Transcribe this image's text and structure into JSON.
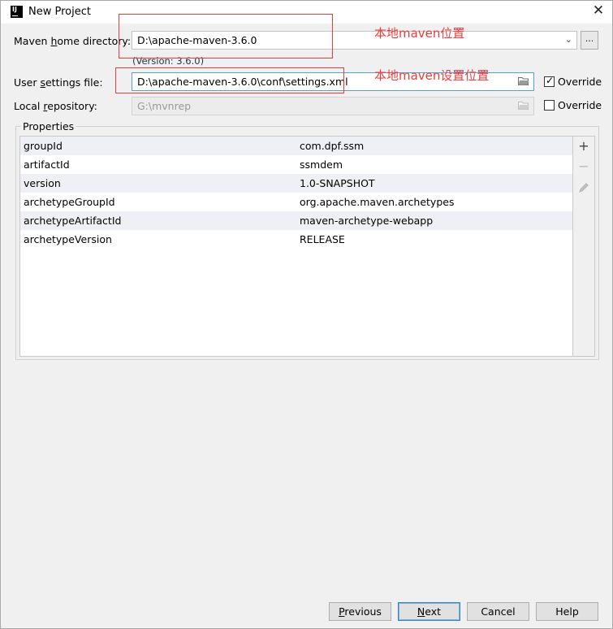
{
  "window": {
    "title": "New Project",
    "icon_text": "IJ"
  },
  "maven": {
    "home_label_pre": "Maven ",
    "home_label_u": "h",
    "home_label_post": "ome directory:",
    "home_value": "D:\\apache-maven-3.6.0",
    "version_text": "(Version: 3.6.0)",
    "settings_label_pre": "User ",
    "settings_label_u": "s",
    "settings_label_post": "ettings file:",
    "settings_value": "D:\\apache-maven-3.6.0\\conf\\settings.xml",
    "settings_override_checked": true,
    "override_label": "Override",
    "repo_label_pre": "Local ",
    "repo_label_u": "r",
    "repo_label_post": "epository:",
    "repo_value": "G:\\mvnrep",
    "repo_override_checked": false,
    "browse_label": "..."
  },
  "annotations": {
    "home_note": "本地maven位置",
    "settings_note": "本地maven设置位置",
    "color": "#e83c3c"
  },
  "properties": {
    "title": "Properties",
    "rows": [
      {
        "key": "groupId",
        "value": "com.dpf.ssm"
      },
      {
        "key": "artifactId",
        "value": "ssmdem"
      },
      {
        "key": "version",
        "value": "1.0-SNAPSHOT"
      },
      {
        "key": "archetypeGroupId",
        "value": "org.apache.maven.archetypes"
      },
      {
        "key": "archetypeArtifactId",
        "value": "maven-archetype-webapp"
      },
      {
        "key": "archetypeVersion",
        "value": "RELEASE"
      }
    ],
    "add_icon": "plus-icon",
    "remove_icon": "minus-icon",
    "edit_icon": "pencil-icon"
  },
  "buttons": {
    "previous_u": "P",
    "previous_rest": "revious",
    "next_u": "N",
    "next_rest": "ext",
    "cancel": "Cancel",
    "help": "Help"
  }
}
